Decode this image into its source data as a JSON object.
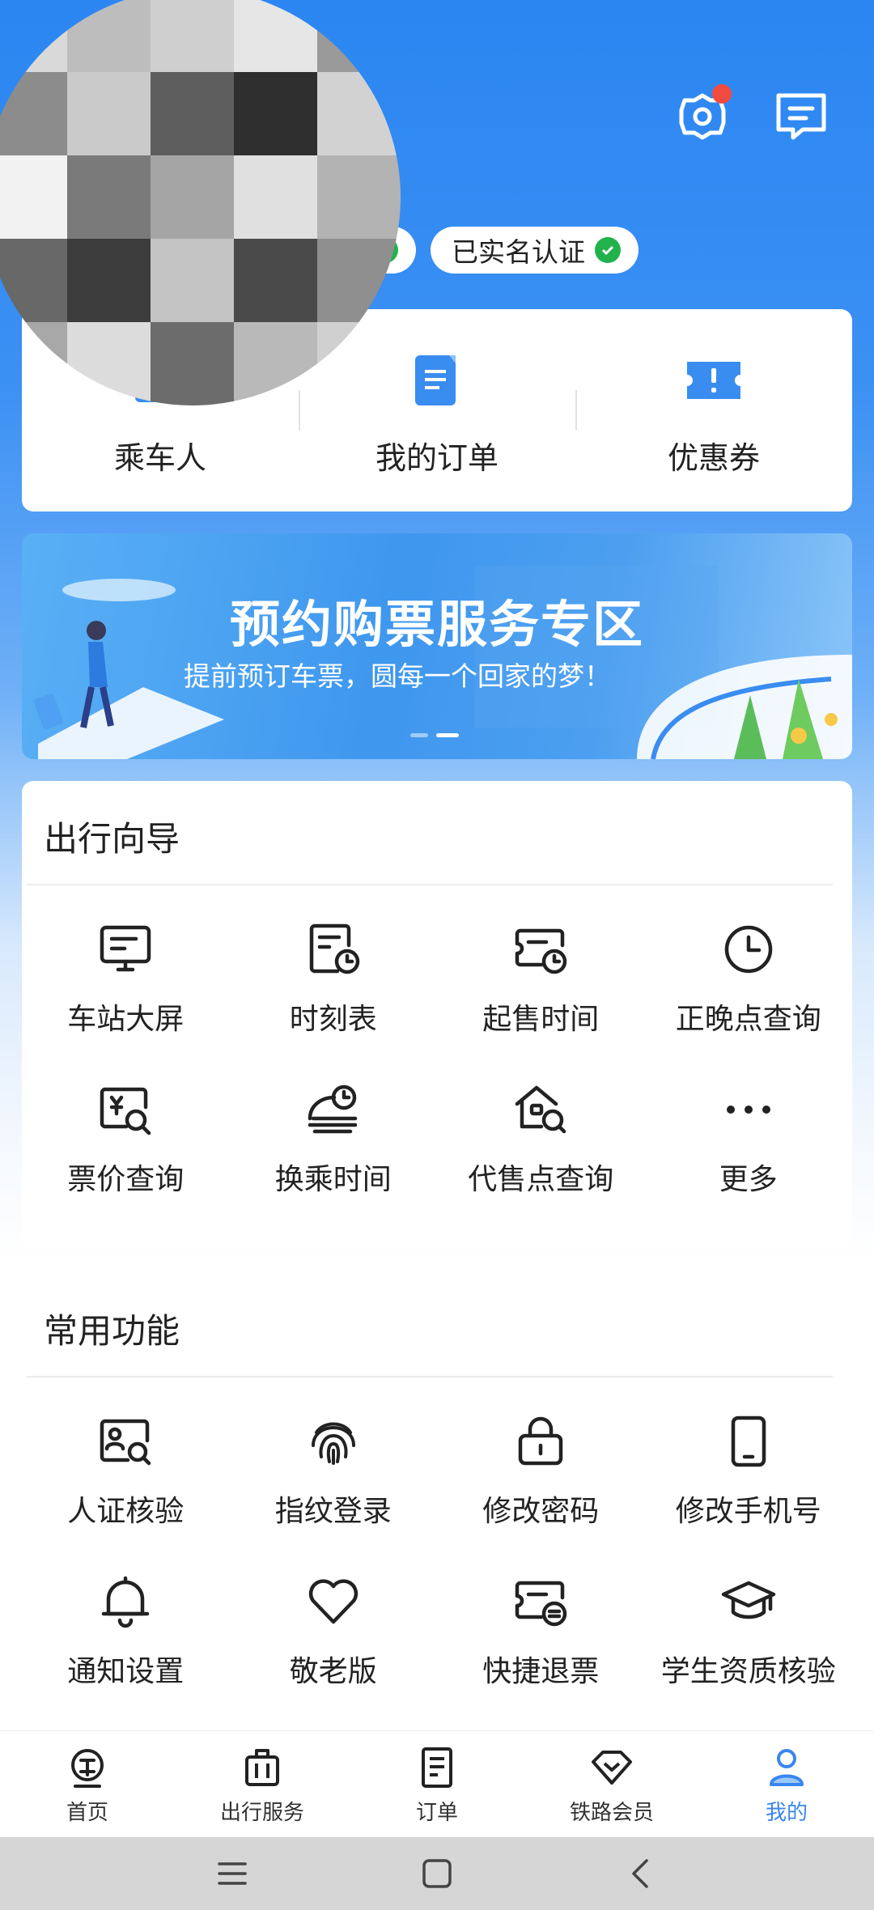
{
  "badges": {
    "second": "已实名认证"
  },
  "quick": [
    {
      "label": "乘车人",
      "icon": "passenger-icon"
    },
    {
      "label": "我的订单",
      "icon": "order-doc-icon"
    },
    {
      "label": "优惠券",
      "icon": "coupon-icon"
    }
  ],
  "banner": {
    "title": "预约购票服务专区",
    "subtitle": "提前预订车票，圆每一个回家的梦！"
  },
  "travel_guide": {
    "title": "出行向导",
    "items": [
      {
        "label": "车站大屏",
        "icon": "station-screen-icon"
      },
      {
        "label": "时刻表",
        "icon": "timetable-icon"
      },
      {
        "label": "起售时间",
        "icon": "sale-time-icon"
      },
      {
        "label": "正晚点查询",
        "icon": "clock-icon"
      },
      {
        "label": "票价查询",
        "icon": "fare-search-icon"
      },
      {
        "label": "换乘时间",
        "icon": "transfer-time-icon"
      },
      {
        "label": "代售点查询",
        "icon": "agency-search-icon"
      },
      {
        "label": "更多",
        "icon": "more-icon"
      }
    ]
  },
  "common": {
    "title": "常用功能",
    "items": [
      {
        "label": "人证核验",
        "icon": "id-verify-icon"
      },
      {
        "label": "指纹登录",
        "icon": "fingerprint-icon"
      },
      {
        "label": "修改密码",
        "icon": "lock-icon"
      },
      {
        "label": "修改手机号",
        "icon": "phone-icon"
      },
      {
        "label": "通知设置",
        "icon": "bell-icon"
      },
      {
        "label": "敬老版",
        "icon": "heart-icon"
      },
      {
        "label": "快捷退票",
        "icon": "refund-ticket-icon"
      },
      {
        "label": "学生资质核验",
        "icon": "graduation-cap-icon"
      }
    ]
  },
  "tabs": [
    {
      "label": "首页",
      "icon": "home-train-icon"
    },
    {
      "label": "出行服务",
      "icon": "luggage-icon"
    },
    {
      "label": "订单",
      "icon": "order-icon"
    },
    {
      "label": "铁路会员",
      "icon": "diamond-icon"
    },
    {
      "label": "我的",
      "icon": "person-icon",
      "active": true
    }
  ],
  "colors": {
    "accent": "#3a86ef",
    "verified": "#22b24c",
    "notify": "#f04b3e"
  }
}
